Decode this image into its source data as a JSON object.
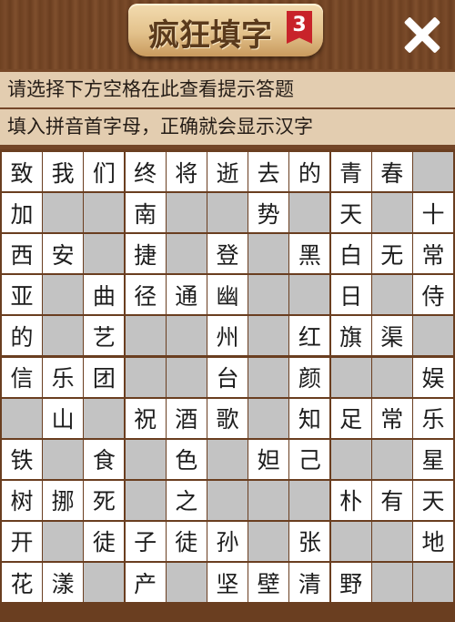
{
  "header": {
    "title": "疯狂填字",
    "level_badge": "3",
    "close_icon": "close-icon"
  },
  "hints": {
    "line1": "请选择下方空格在此查看提示答题",
    "line2": "填入拼音首字母，正确就会显示汉字"
  },
  "colors": {
    "wood": "#6e4122",
    "hint_bg": "#e3cdb0",
    "filled_cell": "#ffffff",
    "empty_cell": "#c3c3c3",
    "badge": "#c8232a"
  },
  "grid": [
    [
      "致",
      "我",
      "们",
      "终",
      "将",
      "逝",
      "去",
      "的",
      "青",
      "春",
      ""
    ],
    [
      "加",
      "",
      "",
      "南",
      "",
      "",
      "势",
      "",
      "天",
      "",
      "十"
    ],
    [
      "西",
      "安",
      "",
      "捷",
      "",
      "登",
      "",
      "黑",
      "白",
      "无",
      "常"
    ],
    [
      "亚",
      "",
      "曲",
      "径",
      "通",
      "幽",
      "",
      "",
      "日",
      "",
      "侍"
    ],
    [
      "的",
      "",
      "艺",
      "",
      "",
      "州",
      "",
      "红",
      "旗",
      "渠",
      ""
    ],
    [
      "信",
      "乐",
      "团",
      "",
      "",
      "台",
      "",
      "颜",
      "",
      "",
      "娱"
    ],
    [
      "",
      "山",
      "",
      "祝",
      "酒",
      "歌",
      "",
      "知",
      "足",
      "常",
      "乐"
    ],
    [
      "铁",
      "",
      "食",
      "",
      "色",
      "",
      "妲",
      "己",
      "",
      "",
      "星"
    ],
    [
      "树",
      "挪",
      "死",
      "",
      "之",
      "",
      "",
      "",
      "朴",
      "有",
      "天"
    ],
    [
      "开",
      "",
      "徒",
      "子",
      "徒",
      "孙",
      "",
      "张",
      "",
      "",
      "地"
    ],
    [
      "花",
      "漾",
      "",
      "产",
      "",
      "坚",
      "壁",
      "清",
      "野",
      "",
      ""
    ]
  ]
}
